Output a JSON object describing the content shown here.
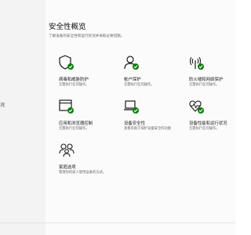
{
  "nav": {
    "partial_label": "况"
  },
  "header": {
    "title": "安全性概览",
    "subtitle": "了解设备的安全性和运行状况并采取必要措施。"
  },
  "tiles": [
    {
      "icon": "shield-icon",
      "title": "病毒和威胁防护",
      "desc": "无需执行任何操作。"
    },
    {
      "icon": "person-icon",
      "title": "帐户保护",
      "desc": "无需执行任何操作。"
    },
    {
      "icon": "wifi-antenna-icon",
      "title": "防火墙和网络保护",
      "desc": "无需执行任何操作。"
    },
    {
      "icon": "app-browser-icon",
      "title": "应用和浏览器控制",
      "desc": "无需执行任何操作。"
    },
    {
      "icon": "laptop-icon",
      "title": "设备安全性",
      "desc": "查看有助于保护设备安全的功能"
    },
    {
      "icon": "heart-pulse-icon",
      "title": "设备性能和运行状况",
      "desc": "无需执行任何操作。"
    },
    {
      "icon": "family-icon",
      "title": "家庭选项",
      "desc": "管理你的家人使用设备的方式。"
    }
  ],
  "colors": {
    "accent": "#0078d4",
    "check": "#107c10"
  }
}
